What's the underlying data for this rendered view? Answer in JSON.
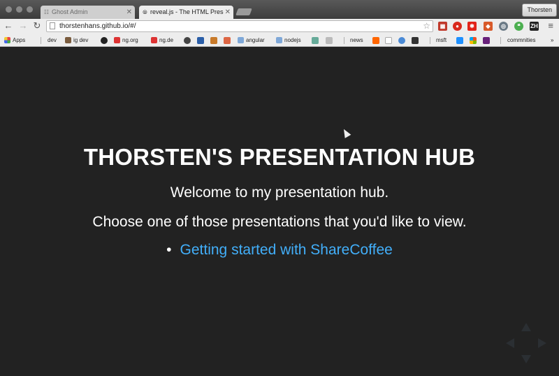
{
  "browser": {
    "tabs": [
      {
        "label": "Ghost Admin",
        "active": false
      },
      {
        "label": "reveal.js - The HTML Presentation Framework",
        "active": true
      }
    ],
    "profile_label": "Thorsten",
    "url": "thorstenhans.github.io/#/",
    "bookmarks": {
      "apps": "Apps",
      "dev": "dev",
      "ig_dev": "ig dev",
      "ng_org": "ng.org",
      "ng_de": "ng.de",
      "angular": "angular",
      "nodejs": "nodejs",
      "news": "news",
      "msft": "msft",
      "communities": "commnities",
      "more": "»"
    }
  },
  "page": {
    "title": "THORSTEN'S PRESENTATION HUB",
    "welcome": "Welcome to my presentation hub.",
    "choose": "Choose one of those presentations that you'd like to view.",
    "presentations": [
      {
        "label": "Getting started with ShareCoffee"
      }
    ]
  },
  "colors": {
    "background": "#222222",
    "text": "#ffffff",
    "link": "#42affa"
  }
}
